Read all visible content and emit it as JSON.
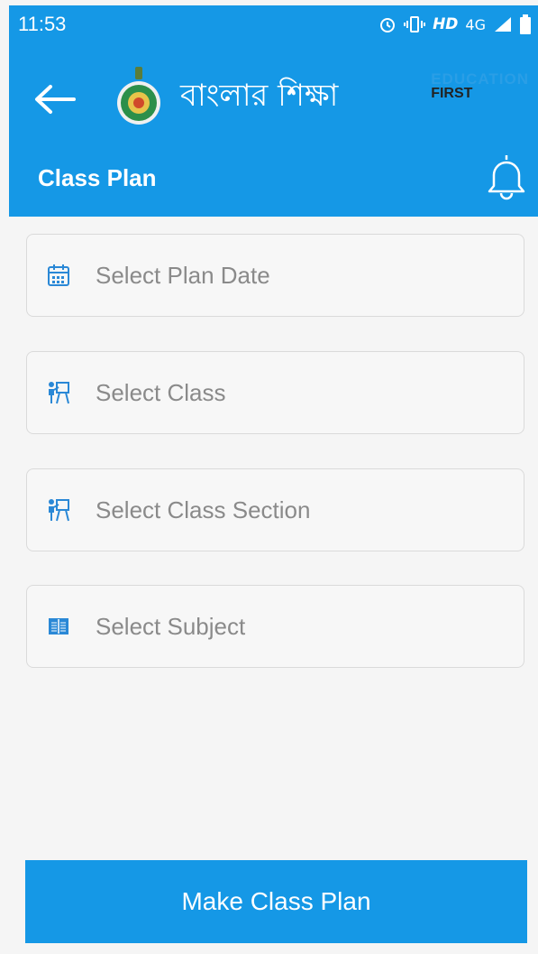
{
  "status_bar": {
    "time": "11:53",
    "network": "HD",
    "signal": "4G"
  },
  "header": {
    "brand": "বাংলার শিক্ষা",
    "partner_line1": "EDUCATION",
    "partner_line2": "FIRST",
    "page_title": "Class Plan"
  },
  "form": {
    "plan_date": "Select Plan Date",
    "class": "Select Class",
    "class_section": "Select Class Section",
    "subject": "Select Subject"
  },
  "actions": {
    "make_plan": "Make Class Plan"
  },
  "colors": {
    "primary": "#1598e6",
    "background": "#f5f5f5",
    "field_border": "#dadada",
    "placeholder": "#8a8a8a"
  }
}
